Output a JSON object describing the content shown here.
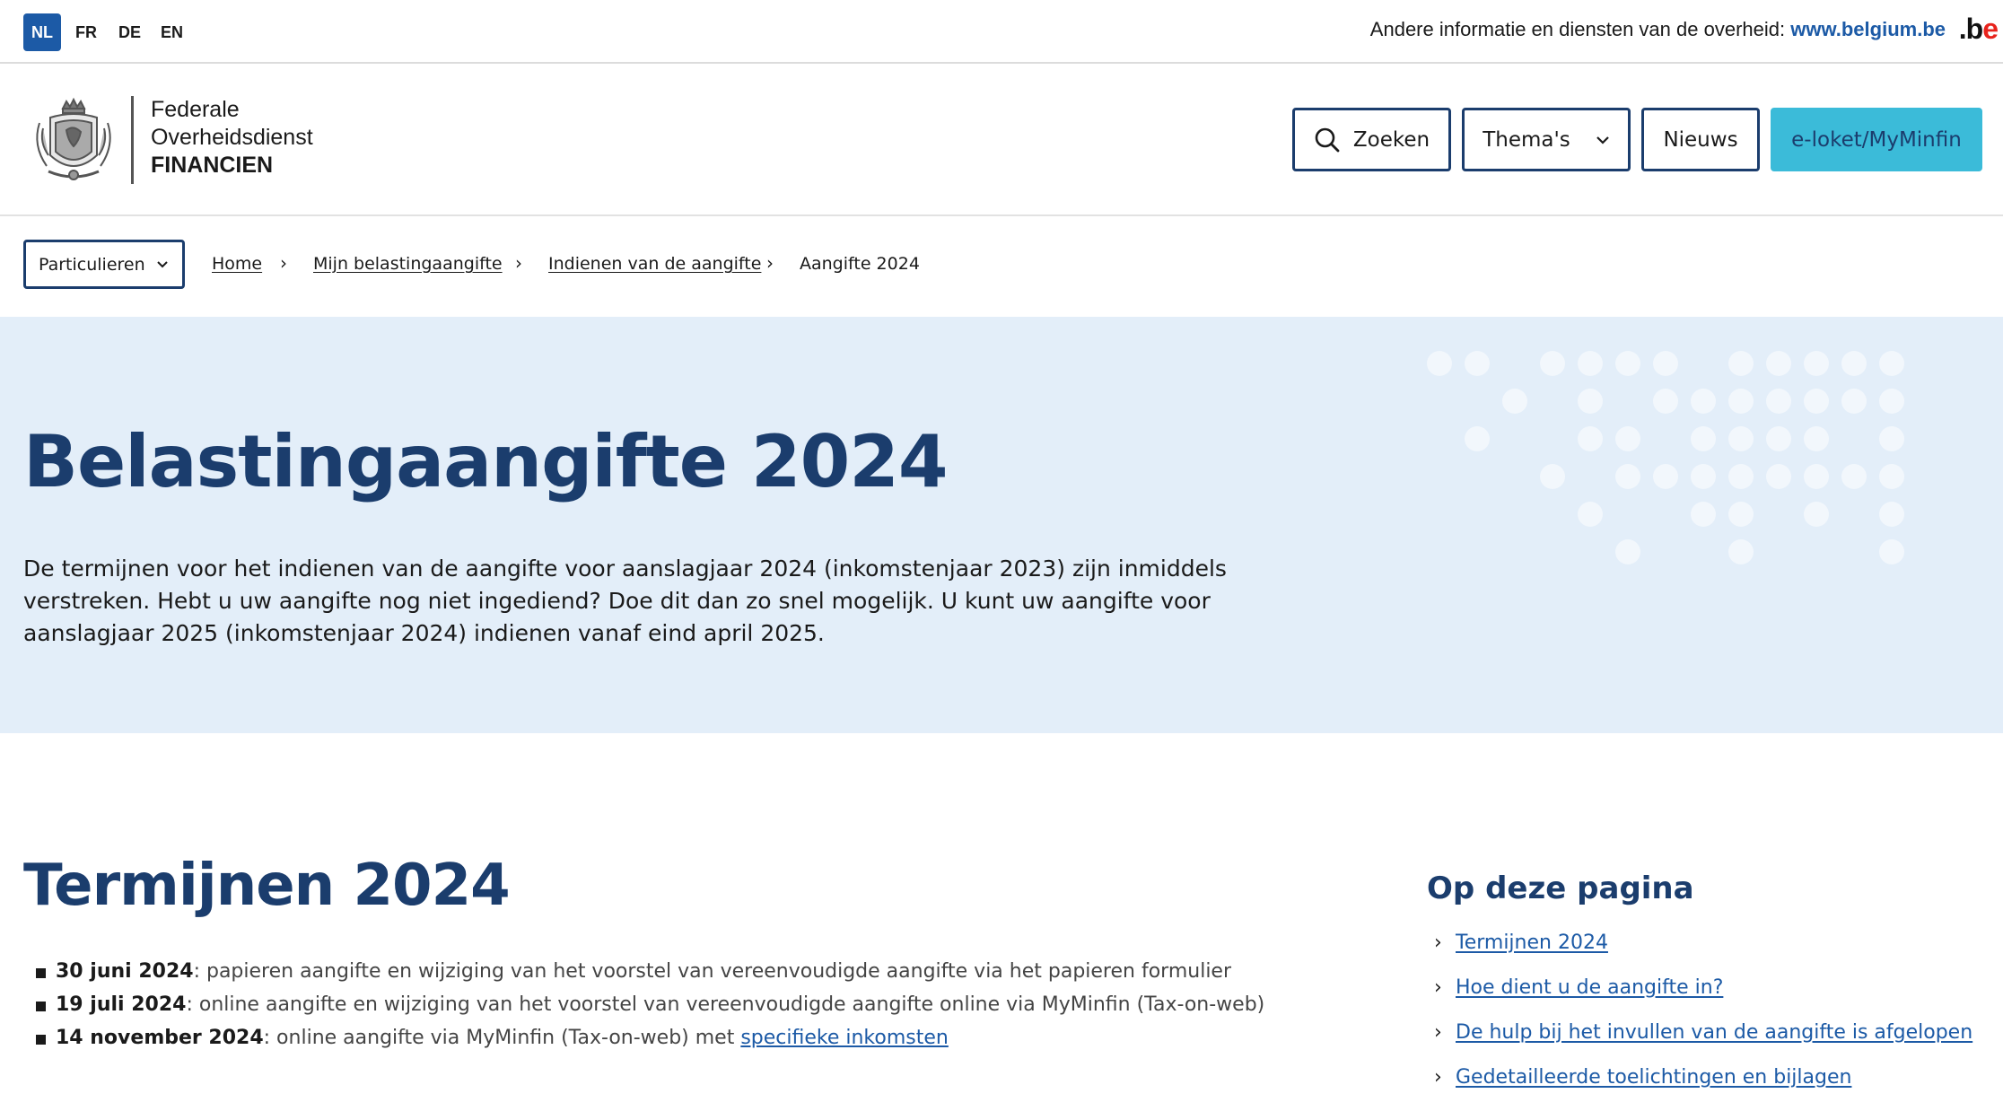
{
  "topbar": {
    "languages": [
      {
        "code": "NL",
        "active": true
      },
      {
        "code": "FR",
        "active": false
      },
      {
        "code": "DE",
        "active": false
      },
      {
        "code": "EN",
        "active": false
      }
    ],
    "gov_text": "Andere informatie en diensten van de overheid:",
    "gov_link": "www.belgium.be",
    "be_logo_dot": ".",
    "be_logo_b": "b",
    "be_logo_e": "e"
  },
  "header": {
    "brand_line1": "Federale",
    "brand_line2": "Overheidsdienst",
    "brand_line3": "FINANCIEN",
    "crest_icon": "belgian-coat-of-arms-icon",
    "nav": {
      "search_label": "Zoeken",
      "themes_label": "Thema's",
      "news_label": "Nieuws",
      "eloket_label": "e-loket/MyMinfin"
    }
  },
  "breadcrumb": {
    "audience_selector": "Particulieren",
    "items": [
      "Home",
      "Mijn belastingaangifte",
      "Indienen van de aangifte",
      "Aangifte 2024"
    ]
  },
  "hero": {
    "title": "Belastingaangifte 2024",
    "intro": "De termijnen voor het indienen van de aangifte voor aanslagjaar 2024 (inkomstenjaar 2023) zijn inmiddels verstreken. Hebt u uw aangifte nog niet ingediend? Doe dit dan zo snel mogelijk. U kunt uw aangifte voor aanslagjaar 2025 (inkomstenjaar 2024) indienen vanaf eind april 2025."
  },
  "deadlines": {
    "title": "Termijnen 2024",
    "items": [
      {
        "date": "30 juni 2024",
        "text": ": papieren aangifte en wijziging van het voorstel van vereenvoudigde aangifte via het papieren formulier",
        "link": ""
      },
      {
        "date": "19 juli 2024",
        "text": ": online aangifte en wijziging van het voorstel van vereenvoudigde aangifte online via MyMinfin (Tax-on-web)",
        "link": ""
      },
      {
        "date": "14 november 2024",
        "text": ": online aangifte via MyMinfin (Tax-on-web) met ",
        "link": "specifieke inkomsten"
      }
    ]
  },
  "toc": {
    "title": "Op deze pagina",
    "items": [
      "Termijnen 2024",
      "Hoe dient u de aangifte in?",
      "De hulp bij het invullen van de aangifte is afgelopen",
      "Gedetailleerde toelichtingen en bijlagen"
    ]
  },
  "colors": {
    "brand_dark": "#1b3d6d",
    "link_blue": "#1c5aa6",
    "accent_cyan": "#3bbbd9",
    "hero_bg": "#e3eef9"
  }
}
